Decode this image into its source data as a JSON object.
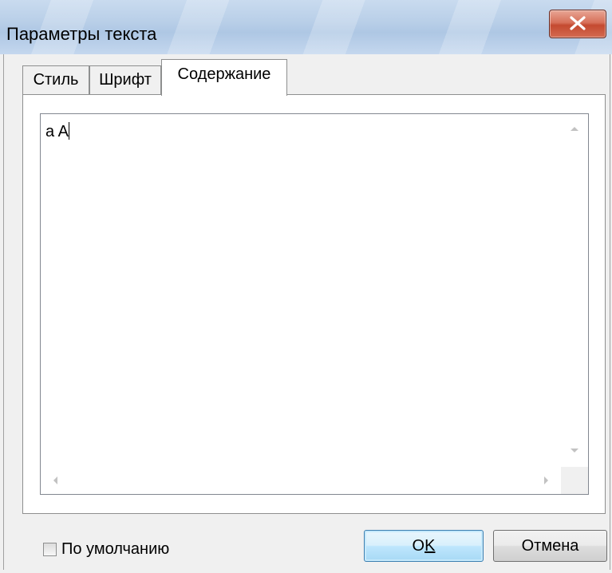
{
  "window": {
    "title": "Параметры текста"
  },
  "tabs": [
    {
      "label": "Стиль",
      "active": false
    },
    {
      "label": "Шрифт",
      "active": false
    },
    {
      "label": "Содержание",
      "active": true
    }
  ],
  "content": {
    "text": "a A"
  },
  "footer": {
    "default_checkbox_label": "По умолчанию",
    "default_checkbox_checked": false,
    "ok_label": "OK",
    "cancel_label": "Отмена"
  },
  "icons": {
    "close": "close-icon",
    "scroll_up": "scroll-up-arrow-icon",
    "scroll_down": "scroll-down-arrow-icon",
    "scroll_left": "scroll-left-arrow-icon",
    "scroll_right": "scroll-right-arrow-icon"
  },
  "colors": {
    "close_button": "#c44a30",
    "default_button_border": "#3c7fb1",
    "tab_border": "#8e8f8f"
  }
}
